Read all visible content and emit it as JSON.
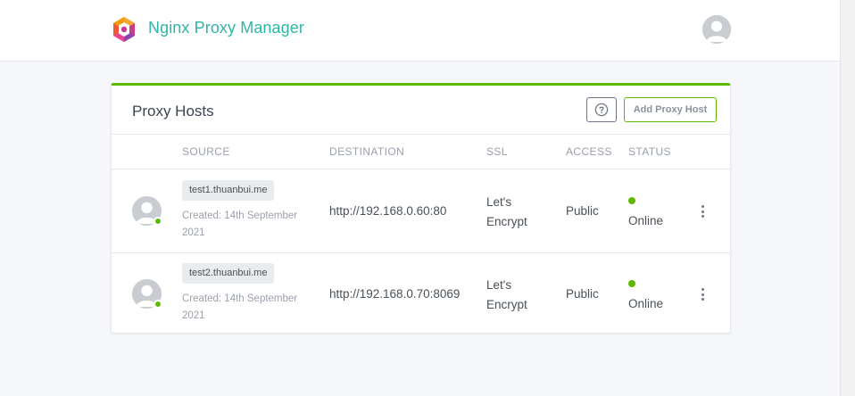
{
  "header": {
    "brand": "Nginx Proxy Manager",
    "logo_icon": "nginx-proxy-manager-logo-icon",
    "avatar_icon": "user-avatar-icon"
  },
  "card": {
    "title": "Proxy Hosts",
    "help_icon": "question-circle-icon",
    "add_button_label": "Add Proxy Host",
    "accent_color": "#5eba00",
    "columns": [
      "SOURCE",
      "DESTINATION",
      "SSL",
      "ACCESS",
      "STATUS"
    ]
  },
  "hosts": [
    {
      "domain": "test1.thuanbui.me",
      "created": "Created: 14th September 2021",
      "destination": "http://192.168.0.60:80",
      "ssl": "Let's Encrypt",
      "access": "Public",
      "status": "Online",
      "status_color": "#5eba00"
    },
    {
      "domain": "test2.thuanbui.me",
      "created": "Created: 14th September 2021",
      "destination": "http://192.168.0.70:8069",
      "ssl": "Let's Encrypt",
      "access": "Public",
      "status": "Online",
      "status_color": "#5eba00"
    }
  ]
}
